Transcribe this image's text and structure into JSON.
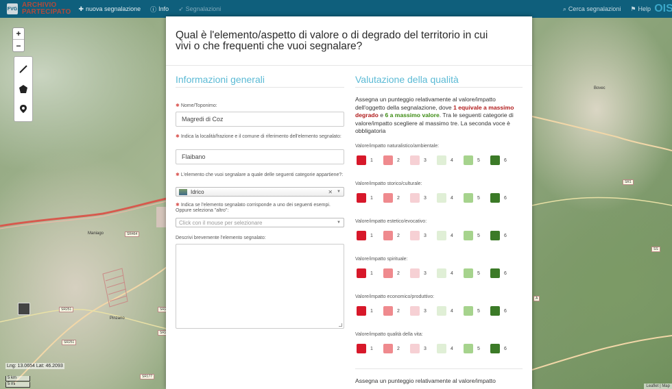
{
  "navbar": {
    "brand_line1": "ARCHIVIO",
    "brand_line2": "PARTECIPATO",
    "logo_text": "FVG",
    "new_report": "nuova segnalazione",
    "info": "Info",
    "reports": "Segnalazioni",
    "search_reports": "Cerca segnalazioni",
    "help": "Help",
    "corner_logo": "OIS"
  },
  "map": {
    "coords": "Lng: 13.0654 Lat: 46.2093",
    "scale_km": "5 km",
    "scale_mi": "5 mi",
    "attribution": "Leaflet | Map",
    "labels": {
      "town": "Maniago",
      "bovec": "Bovec",
      "pinzano": "Pinzano"
    },
    "roads": {
      "sr464a": "SR464",
      "sr251a": "SR251",
      "sr251b": "SR251",
      "sr177": "SR177",
      "sr24a": "SR2",
      "sr24b": "SR2",
      "sr1": "SR1",
      "a": "A",
      "ss": "SS"
    }
  },
  "modal": {
    "title": "Qual è l'elemento/aspetto di valore o di degrado del territorio in cui vivi o che frequenti che vuoi segnalare?",
    "general": {
      "heading": "Informazioni generali",
      "name_label": "Nome/Toponimo:",
      "name_value": "Magredi di Coz",
      "locality_label": "Indica la località/frazione e il comune di riferimento dell'elemento segnalato:",
      "locality_value": "Flaibano",
      "category_label": "L'elemento che vuoi segnalare a quale delle seguenti categorie appartiene?:",
      "category_value": "Idrico",
      "example_label": "Indica se l'elemento segnalato corrisponde a uno dei seguenti esempi. Oppure seleziona \"altro\":",
      "example_placeholder": "Click con il mouse per selezionare",
      "describe_label": "Descrivi brevemente l'elemento segnalato:"
    },
    "quality": {
      "heading": "Valutazione della qualità",
      "intro_1": "Assegna un punteggio relativamente al valore/impatto dell'oggetto della segnalazione, dove ",
      "intro_red": "1 equivale a massimo degrado",
      "intro_2": " e ",
      "intro_green": "6 a massimo valore",
      "intro_3": ". Tra le seguenti categorie di valore/impatto scegliere al massimo tre. La seconda voce è obbligatoria",
      "intro_second": "Assegna un punteggio relativamente al valore/impatto",
      "scale": [
        "1",
        "2",
        "3",
        "4",
        "5",
        "6"
      ],
      "scale_colors": [
        "#d7182a",
        "#ef8a8e",
        "#f6d0d4",
        "#e0efd6",
        "#a6d38d",
        "#3b7a27"
      ],
      "ratings": [
        {
          "label": "Valore/impatto naturalistico/ambientale:"
        },
        {
          "label": "Valore/impatto storico/culturale:"
        },
        {
          "label": "Valore/impatto estetico/evocativo:"
        },
        {
          "label": "Valore/impatto spirituale:"
        },
        {
          "label": "Valore/impatto economico/produttivo:"
        },
        {
          "label": "Valore/impatto qualità della vita:"
        }
      ]
    }
  }
}
